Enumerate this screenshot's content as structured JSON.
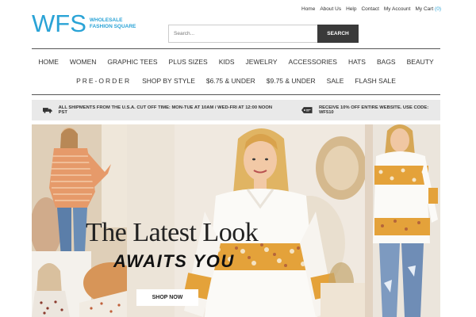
{
  "logo": {
    "mark": "WFS",
    "text": "WHOLESALE FASHION SQUARE"
  },
  "toplinks": {
    "home": "Home",
    "about": "About Us",
    "help": "Help",
    "contact": "Contact",
    "account": "My Account",
    "cart": "My Cart",
    "cart_count": "(0)"
  },
  "search": {
    "placeholder": "Search...",
    "button": "SEARCH"
  },
  "nav": {
    "row1": [
      "HOME",
      "WOMEN",
      "GRAPHIC TEES",
      "PLUS SIZES",
      "KIDS",
      "JEWELRY",
      "ACCESSORIES",
      "HATS",
      "BAGS",
      "BEAUTY"
    ],
    "row2": [
      "PRE-ORDER",
      "SHOP BY STYLE",
      "$6.75 & UNDER",
      "$9.75 & UNDER",
      "SALE",
      "FLASH SALE"
    ]
  },
  "shipbar": {
    "left_icon": "truck-icon",
    "left": "ALL SHIPMENTS FROM THE U.S.A. CUT OFF TIME: MON-TUE AT 10AM / WED-FRI AT 12:00 NOON PST",
    "right_icon": "tag-icon",
    "right": "RECEIVE 10% OFF ENTIRE WEBSITE. USE CODE: WF510"
  },
  "hero": {
    "headline": "The Latest Look",
    "subheadline": "AWAITS YOU",
    "cta": "SHOP NOW"
  },
  "colors": {
    "brand": "#2aa3d6",
    "search_button": "#3a3a3a",
    "shipbar_bg": "#e9e9e9"
  }
}
